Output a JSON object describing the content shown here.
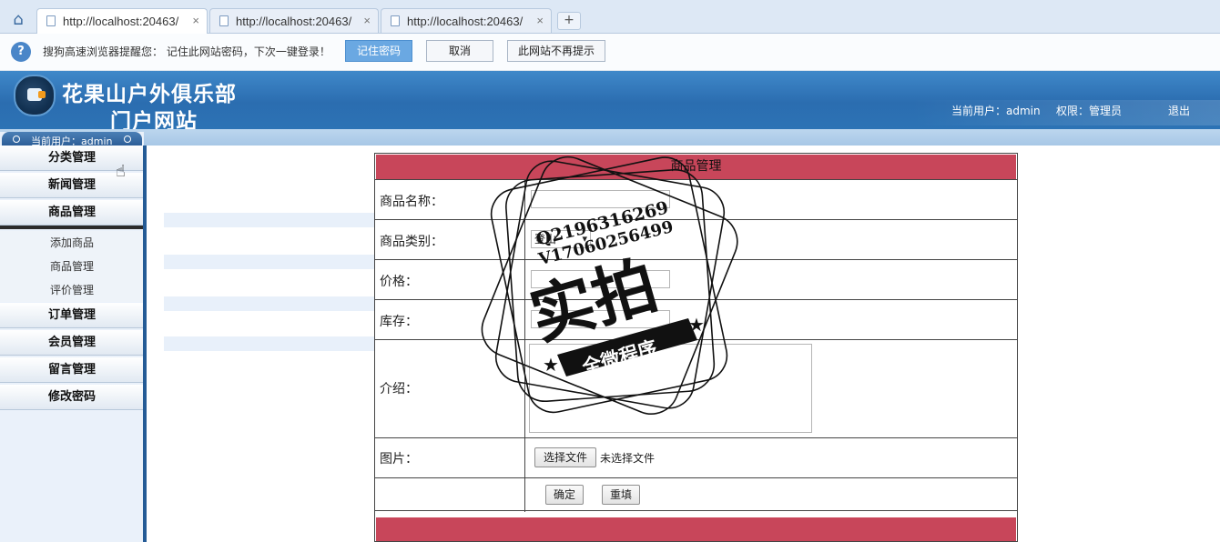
{
  "browser": {
    "tabs": [
      {
        "title": "http://localhost:20463/",
        "close": "×",
        "active": true
      },
      {
        "title": "http://localhost:20463/",
        "close": "×",
        "active": false
      },
      {
        "title": "http://localhost:20463/",
        "close": "×",
        "active": false
      }
    ],
    "new_tab": "+",
    "password_bar": {
      "message": "搜狗高速浏览器提醒您： 记住此网站密码，下次一键登录！",
      "remember": "记住密码",
      "cancel": "取消",
      "never": "此网站不再提示"
    }
  },
  "header": {
    "title_line1": "花果山户外俱乐部",
    "title_line2": "门户网站",
    "current_user": "当前用户：admin",
    "role": "权限：管理员",
    "logout": "退出"
  },
  "sidebar": {
    "user_pill": "当前用户：admin",
    "items": [
      {
        "label": "分类管理"
      },
      {
        "label": "新闻管理"
      },
      {
        "label": "商品管理"
      }
    ],
    "sub_items": [
      {
        "label": "添加商品"
      },
      {
        "label": "商品管理"
      },
      {
        "label": "评价管理"
      }
    ],
    "items_after": [
      {
        "label": "订单管理"
      },
      {
        "label": "会员管理"
      },
      {
        "label": "留言管理"
      },
      {
        "label": "修改密码"
      }
    ]
  },
  "form": {
    "heading": "商品管理",
    "name_label": "商品名称：",
    "category_label": "商品类别：",
    "category_value": "登山",
    "price_label": "价格：",
    "stock_label": "库存：",
    "intro_label": "介绍：",
    "image_label": "图片：",
    "choose_file": "选择文件",
    "no_file": "未选择文件",
    "confirm": "确定",
    "reset": "重填"
  },
  "watermark": {
    "line1": "Q2196316269",
    "line2": "V17060256499",
    "big": "实拍",
    "banner": "全微程序"
  },
  "colors": {
    "accent_red": "#c8465a",
    "header_blue": "#2b6db0",
    "sidebar_bg": "#eaf1fa"
  }
}
